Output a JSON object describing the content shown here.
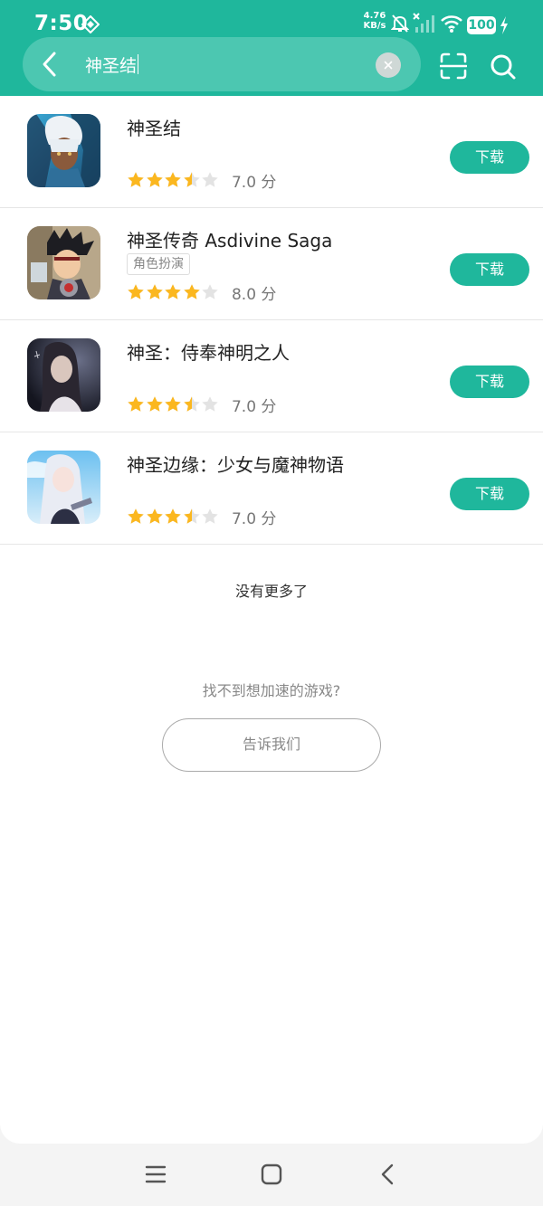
{
  "status_bar": {
    "time": "7:50",
    "net_speed_value": "4.76",
    "net_speed_unit": "KB/s",
    "battery": "100"
  },
  "search": {
    "query": "神圣结"
  },
  "results": [
    {
      "name": "神圣结",
      "tag": "",
      "rating": 3.5,
      "score": "7.0 分",
      "download_label": "下载"
    },
    {
      "name": "神圣传奇 Asdivine Saga",
      "tag": "角色扮演",
      "rating": 4,
      "score": "8.0 分",
      "download_label": "下载"
    },
    {
      "name": "神圣：侍奉神明之人",
      "tag": "",
      "rating": 3.5,
      "score": "7.0 分",
      "download_label": "下载"
    },
    {
      "name": "神圣边缘：少女与魔神物语",
      "tag": "",
      "rating": 3.5,
      "score": "7.0 分",
      "download_label": "下载"
    }
  ],
  "footer": {
    "no_more": "没有更多了",
    "not_found": "找不到想加速的游戏?",
    "tell_us": "告诉我们"
  },
  "icons": {
    "back": "chevron-left-icon",
    "clear": "clear-icon",
    "scan": "scan-icon",
    "search": "search-icon",
    "nav_menu": "menu-icon",
    "nav_home": "home-icon",
    "nav_back": "back-icon"
  },
  "colors": {
    "brand": "#1fb79c",
    "star": "#fbb71f",
    "star_empty": "#e3e3e3"
  }
}
